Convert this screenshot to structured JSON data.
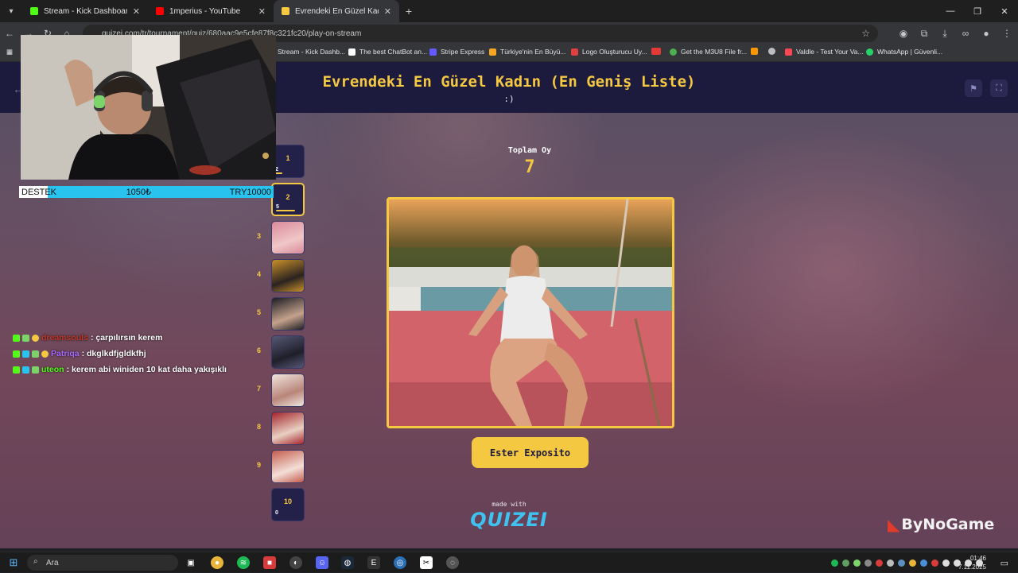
{
  "browser": {
    "tabs": [
      {
        "title": "Stream - Kick Dashboard",
        "color": "#53fc18",
        "active": false
      },
      {
        "title": "1mperius - YouTube",
        "color": "#ff0000",
        "active": false
      },
      {
        "title": "Evrendeki En Güzel Kadın (En G",
        "color": "#f5c842",
        "active": true
      }
    ],
    "url": "quizei.com/tr/tournament/quiz/680aac9e5cfe87f8c321fc20/play-on-stream",
    "bookmarks": [
      {
        "label": "Stream - Kick Dashb...",
        "color": "#53fc18"
      },
      {
        "label": "The best ChatBot an...",
        "color": "#ffffff"
      },
      {
        "label": "Stripe Express",
        "color": "#635bff"
      },
      {
        "label": "Türkiye'nin En Büyü...",
        "color": "#f5a623"
      },
      {
        "label": "Logo Oluşturucu Uy...",
        "color": "#e04040"
      },
      {
        "label": "",
        "color": "#e53935"
      },
      {
        "label": "Get the M3U8 File fr...",
        "color": "#4caf50"
      },
      {
        "label": "",
        "color": "#bdbdbd"
      },
      {
        "label": "",
        "color": "#ff9800"
      },
      {
        "label": "Valdle - Test Your Va...",
        "color": "#ff4655"
      },
      {
        "label": "WhatsApp | Güvenli...",
        "color": "#25d366"
      }
    ]
  },
  "quiz": {
    "title": "Evrendeki En Güzel Kadın (En Geniş Liste)",
    "subtitle": ":)",
    "total_label": "Toplam Oy",
    "total_votes": "7",
    "current_name": "Ester Exposito",
    "made_with": "made with",
    "brand": "QUIZEI"
  },
  "ranking": [
    {
      "rank": "1",
      "label": "1",
      "count": "2",
      "bar": 0.25,
      "thumb": false
    },
    {
      "rank": "",
      "label": "2",
      "count": "5",
      "bar": 0.7,
      "thumb": false,
      "selected": true
    },
    {
      "rank": "3",
      "label": "",
      "count": "",
      "bar": 0,
      "thumb": true,
      "tone": [
        "#d98a9b",
        "#f0c7c7"
      ]
    },
    {
      "rank": "4",
      "label": "",
      "count": "",
      "bar": 0,
      "thumb": true,
      "tone": [
        "#c9902b",
        "#2b2320"
      ]
    },
    {
      "rank": "5",
      "label": "",
      "count": "",
      "bar": 0,
      "thumb": true,
      "tone": [
        "#1c1c24",
        "#c5a28b"
      ]
    },
    {
      "rank": "6",
      "label": "",
      "count": "",
      "bar": 0,
      "thumb": true,
      "tone": [
        "#565876",
        "#1f1f2a"
      ]
    },
    {
      "rank": "7",
      "label": "",
      "count": "",
      "bar": 0,
      "thumb": true,
      "tone": [
        "#efe6df",
        "#b9857a"
      ]
    },
    {
      "rank": "8",
      "label": "",
      "count": "",
      "bar": 0,
      "thumb": true,
      "tone": [
        "#a4242c",
        "#e9d0c2"
      ]
    },
    {
      "rank": "9",
      "label": "",
      "count": "",
      "bar": 0,
      "thumb": true,
      "tone": [
        "#c45b4b",
        "#f3dfd8"
      ]
    },
    {
      "rank": "",
      "label": "10",
      "count": "0",
      "bar": 0,
      "thumb": false
    }
  ],
  "overlay": {
    "destek": "DESTEK",
    "amount_tl": "1050₺",
    "amount_try": "TRY10000",
    "chat": [
      {
        "user": "dreamsouls",
        "user_color": "#c0392b",
        "message": ": çarpılırsın kerem"
      },
      {
        "user": "Patriqa",
        "user_color": "#a86bff",
        "message": ": dkglkdfjgldkfhj"
      },
      {
        "user": "uteon",
        "user_color": "#53fc18",
        "message": ": kerem abi winiden 10 kat daha yakışıklı"
      }
    ],
    "sponsor": "ByNoGame"
  },
  "taskbar": {
    "search_placeholder": "Ara",
    "time": "01:46",
    "date": "7.11.2025"
  }
}
